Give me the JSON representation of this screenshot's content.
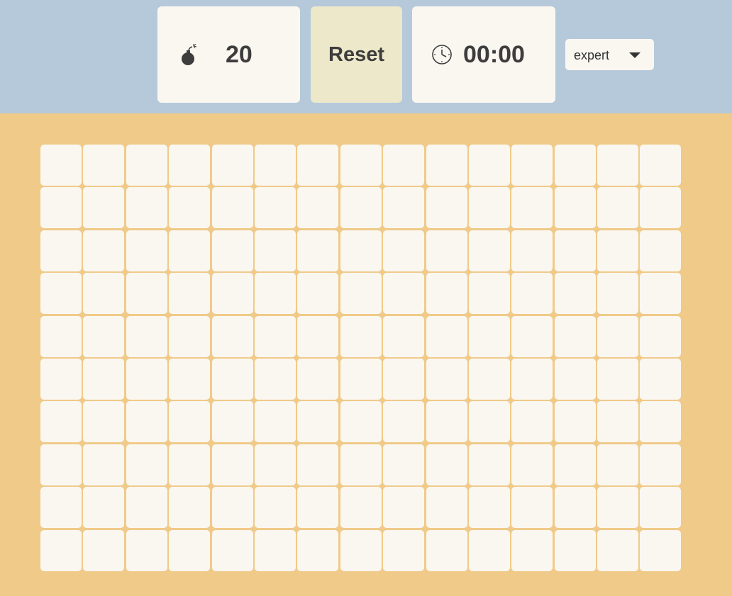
{
  "header": {
    "mine_icon": "bomb-icon",
    "mines_remaining": "20",
    "reset_label": "Reset",
    "timer_icon": "clock-icon",
    "timer": "00:00",
    "difficulty": {
      "selected": "expert"
    }
  },
  "board": {
    "rows": 10,
    "columns": 15,
    "cell_state": "hidden"
  },
  "colors": {
    "header_bg": "#b6c9db",
    "board_bg": "#f0ca89",
    "panel_bg": "#faf7f1",
    "reset_bg": "#ece8c9",
    "text": "#3d3d3d"
  }
}
